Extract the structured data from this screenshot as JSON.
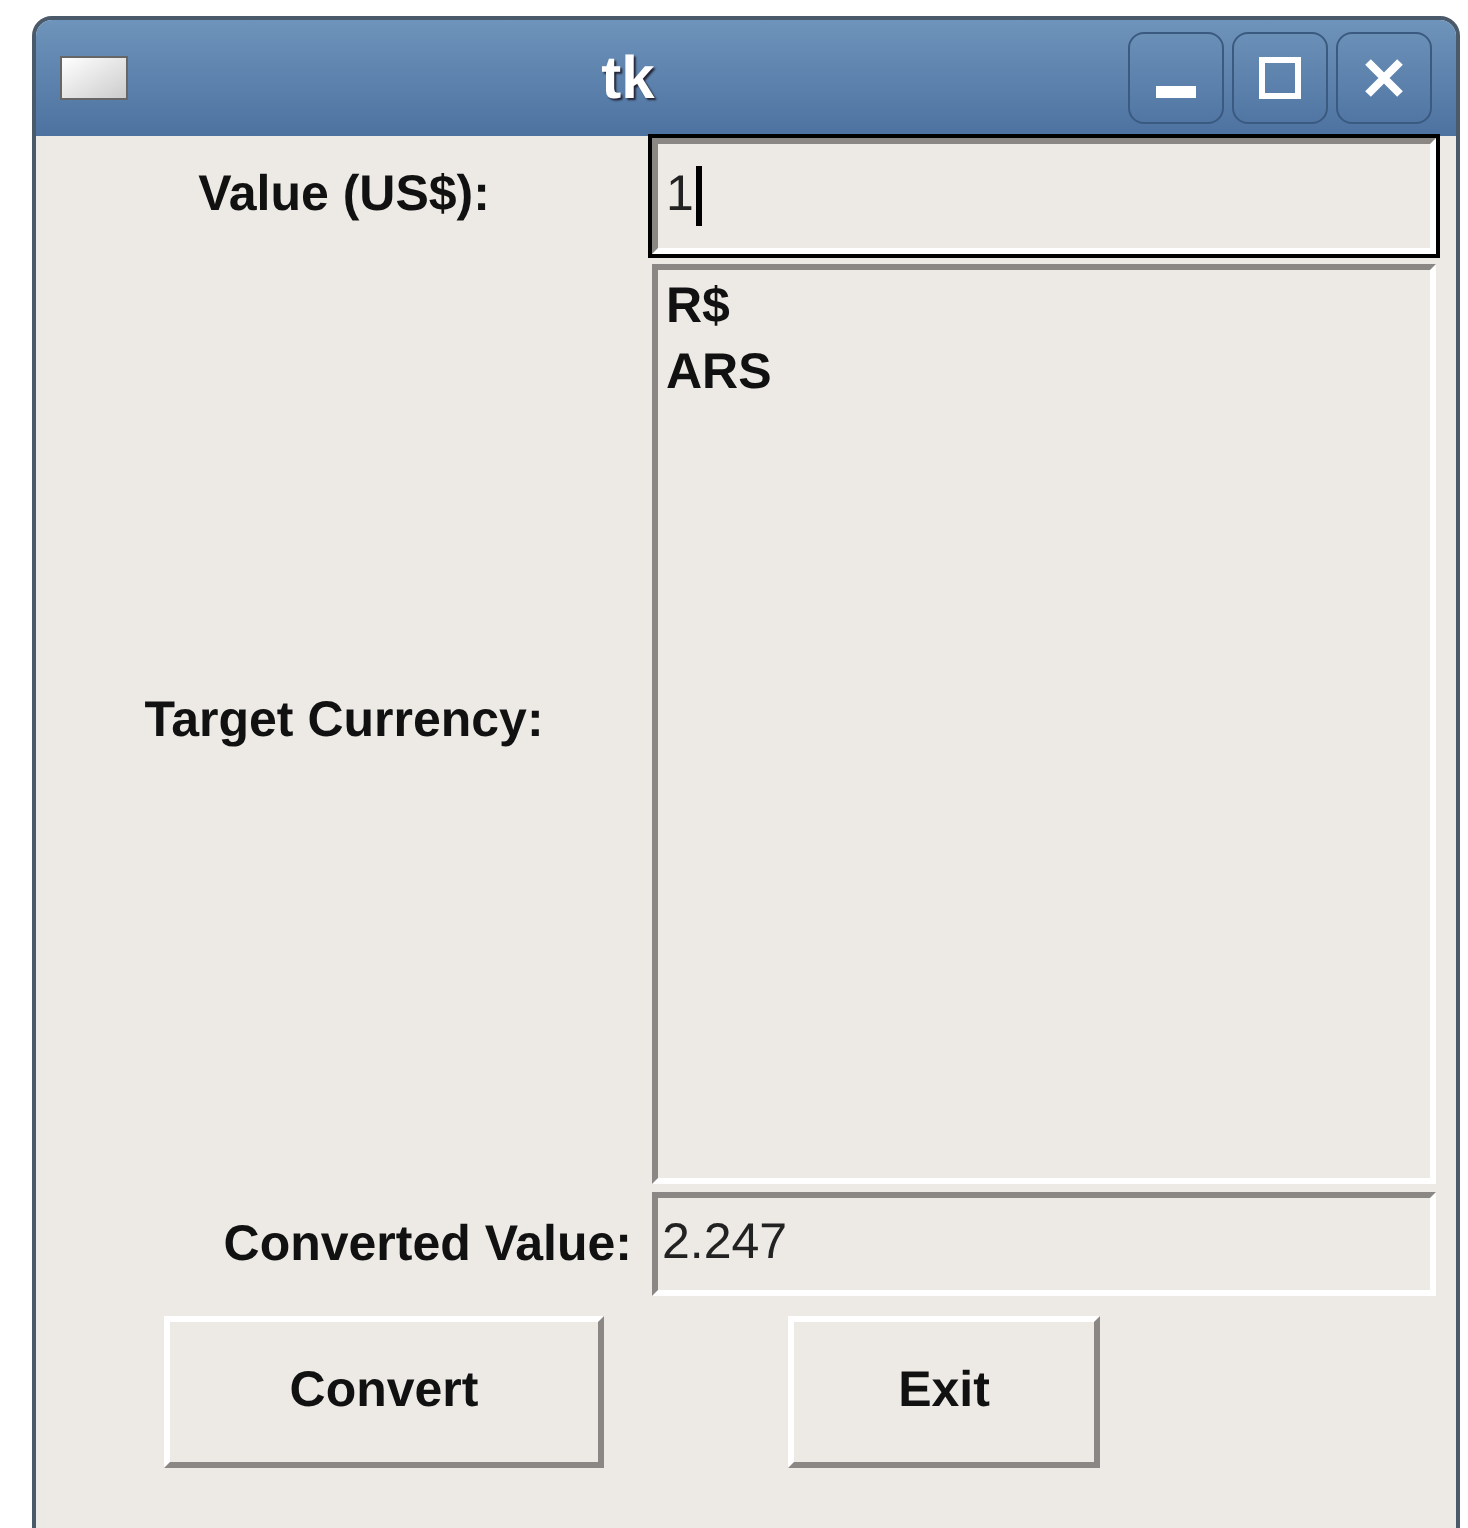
{
  "window": {
    "title": "tk"
  },
  "value_row": {
    "label": "Value (US$):",
    "value": "1",
    "focused": true
  },
  "currency_row": {
    "label": "Target Currency:",
    "items": [
      "R$",
      "ARS"
    ]
  },
  "converted_row": {
    "label": "Converted Value:",
    "value": "2.247"
  },
  "buttons": [
    "Convert",
    "Exit"
  ]
}
